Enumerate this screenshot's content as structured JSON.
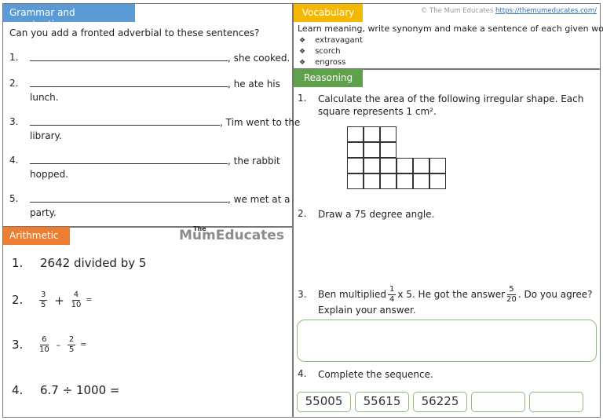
{
  "header": {
    "copyright_text": "© The Mum Educates",
    "copyright_link": "https://themumeducates.com/"
  },
  "grammar": {
    "title": "Grammar and punctuation",
    "instruction": "Can you add a fronted adverbial to these sentences?",
    "items": [
      {
        "num": "1.",
        "ending": ", she cooked.",
        "continuation": ""
      },
      {
        "num": "2.",
        "ending": ", he ate his",
        "continuation": "lunch."
      },
      {
        "num": "3.",
        "ending": ", Tim went to the",
        "continuation": "library."
      },
      {
        "num": "4.",
        "ending": ", the rabbit",
        "continuation": "hopped."
      },
      {
        "num": "5.",
        "ending": ", we met at a",
        "continuation": "party."
      }
    ]
  },
  "vocabulary": {
    "title": "Vocabulary",
    "instruction": "Learn meaning, write synonym and make a sentence of each given word.",
    "bullet_icon": "❖",
    "words": [
      "extravagant",
      "scorch",
      "engross"
    ]
  },
  "reasoning": {
    "title": "Reasoning",
    "q1": {
      "num": "1.",
      "line1": "Calculate the area of the following irregular shape. Each",
      "line2": "square represents 1 cm²."
    },
    "shape_grid": {
      "rows": 4,
      "description": "top 2 rows: 3 squares; bottom 2 rows: 6 squares",
      "row_lengths": [
        3,
        3,
        6,
        6
      ]
    },
    "q2": {
      "num": "2.",
      "text": "Draw a 75 degree angle."
    },
    "q3": {
      "num": "3.",
      "part1": "Ben multiplied",
      "frac1_num": "1",
      "frac1_den": "4",
      "part2": "x 5. He got the answer",
      "frac2_num": "5",
      "frac2_den": "20",
      "part3": ". Do you agree?",
      "line2": "Explain your answer."
    },
    "q4": {
      "num": "4.",
      "text": "Complete the sequence.",
      "sequence": [
        "55005",
        "55615",
        "56225",
        "",
        ""
      ]
    }
  },
  "arithmetic": {
    "title": "Arithmetic",
    "logo_the": "The",
    "logo_text": "MumEducates",
    "q1": {
      "num": "1.",
      "text": "2642 divided by 5"
    },
    "q2": {
      "num": "2.",
      "a_num": "3",
      "a_den": "5",
      "op": "+",
      "b_num": "4",
      "b_den": "10",
      "eq": "="
    },
    "q3": {
      "num": "3.",
      "a_num": "6",
      "a_den": "10",
      "op": "–",
      "b_num": "2",
      "b_den": "5",
      "eq": "="
    },
    "q4": {
      "num": "4.",
      "text": "6.7 ÷ 1000 ="
    }
  }
}
